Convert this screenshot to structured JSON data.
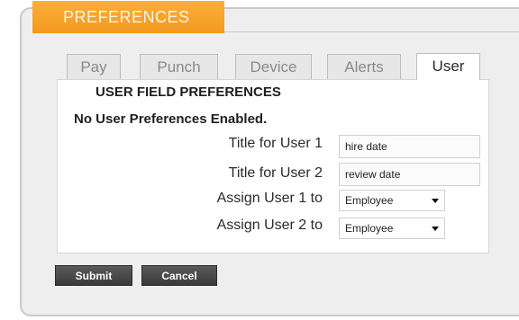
{
  "header": {
    "title": "PREFERENCES"
  },
  "tabs": [
    {
      "label": "Pay",
      "active": false
    },
    {
      "label": "Punch",
      "active": false
    },
    {
      "label": "Device",
      "active": false
    },
    {
      "label": "Alerts",
      "active": false
    },
    {
      "label": "User",
      "active": true
    }
  ],
  "section": {
    "title": "USER FIELD PREFERENCES",
    "notice": "No User Preferences Enabled."
  },
  "fields": {
    "title_user1": {
      "label": "Title for User 1",
      "value": "hire date"
    },
    "title_user2": {
      "label": "Title for User 2",
      "value": "review date"
    },
    "assign_user1": {
      "label": "Assign User 1 to",
      "selected": "Employee"
    },
    "assign_user2": {
      "label": "Assign User 2 to",
      "selected": "Employee"
    }
  },
  "buttons": {
    "submit": "Submit",
    "cancel": "Cancel"
  },
  "colors": {
    "header_tab": "#f39a1f",
    "header_text": "#fff4e0",
    "panel_bg": "#eeeeee",
    "button_bg": "#4a4a4a"
  }
}
